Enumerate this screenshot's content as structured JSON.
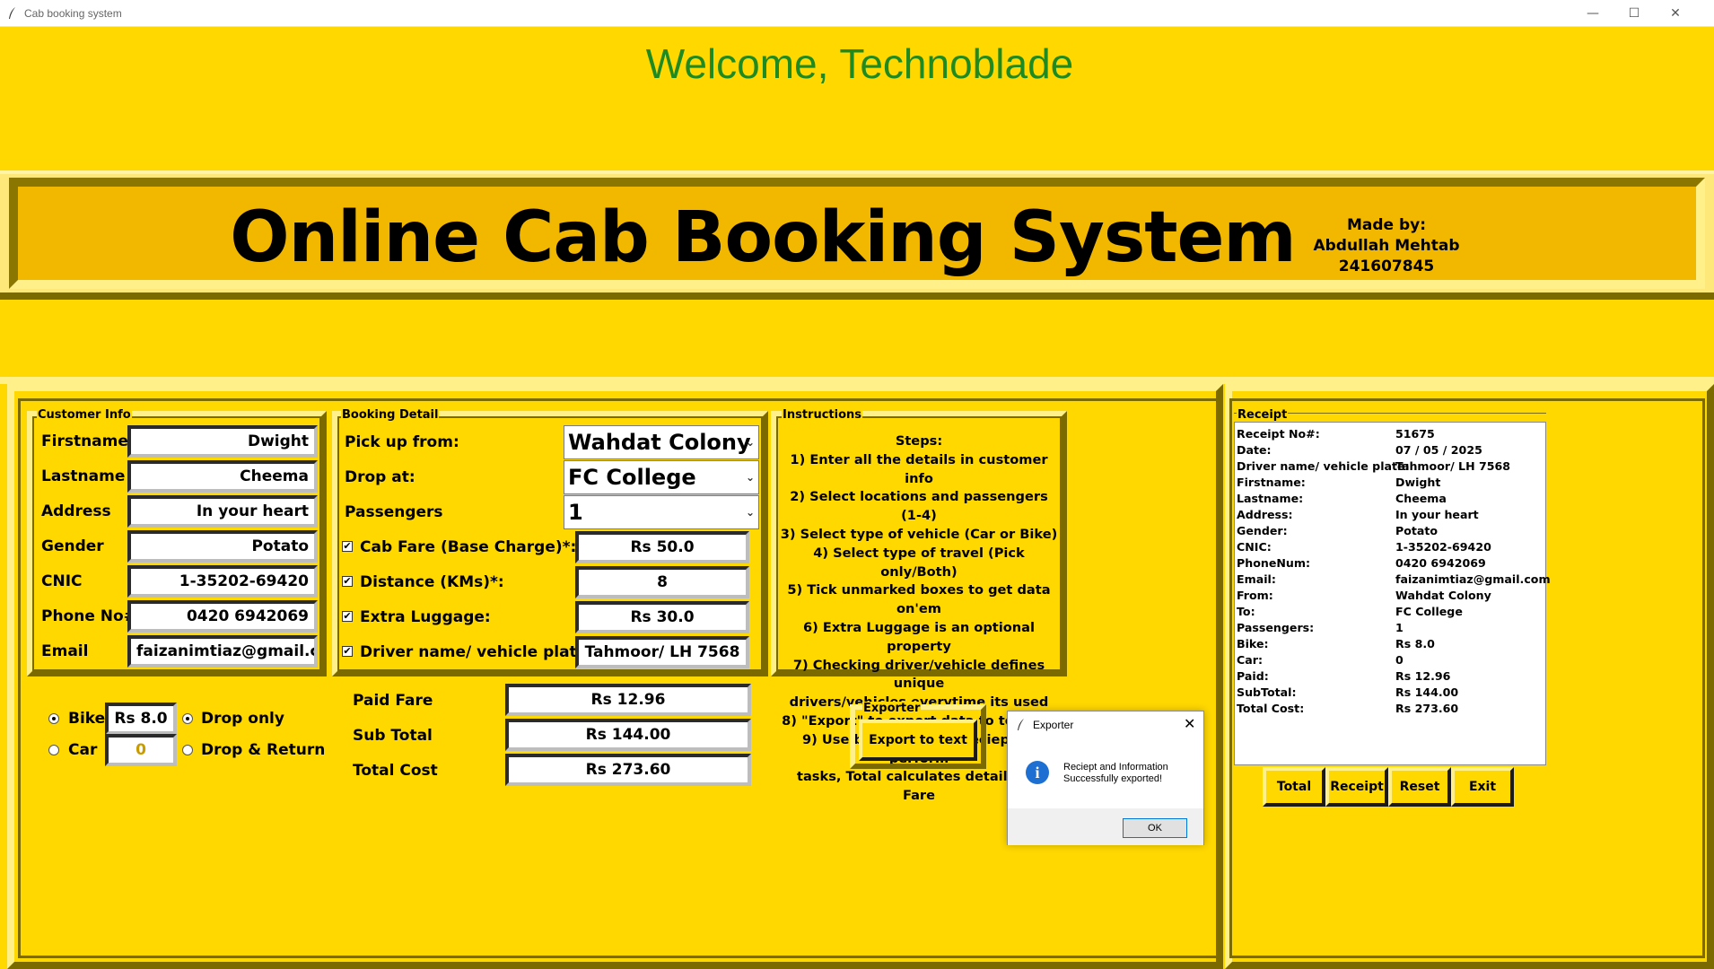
{
  "window": {
    "title": "Cab booking system",
    "minimize": "—",
    "maximize": "☐",
    "close": "✕"
  },
  "welcome": "Welcome, Technoblade",
  "header": {
    "title": "Online Cab Booking System",
    "made_by_label": "Made by:",
    "author": "Abdullah Mehtab",
    "id": "241607845"
  },
  "customer_info": {
    "group_label": "Customer Info",
    "fields": [
      {
        "label": "Firstname",
        "value": "Dwight"
      },
      {
        "label": "Lastname",
        "value": "Cheema"
      },
      {
        "label": "Address",
        "value": "In your heart"
      },
      {
        "label": "Gender",
        "value": "Potato"
      },
      {
        "label": "CNIC",
        "value": "1-35202-69420"
      },
      {
        "label": "Phone No#",
        "value": "0420 6942069"
      },
      {
        "label": "Email",
        "value": "faizanimtiaz@gmail.com"
      }
    ]
  },
  "booking": {
    "group_label": "Booking Detail",
    "pickup_label": "Pick up from:",
    "pickup_value": "Wahdat Colony",
    "drop_label": "Drop at:",
    "drop_value": "FC College",
    "passengers_label": "Passengers",
    "passengers_value": "1",
    "checks": [
      {
        "label": "Cab Fare (Base Charge)*:",
        "value": "Rs 50.0",
        "checked": true
      },
      {
        "label": "Distance (KMs)*:",
        "value": "8",
        "checked": true
      },
      {
        "label": "Extra Luggage:",
        "value": "Rs 30.0",
        "checked": true
      },
      {
        "label": "Driver name/ vehicle plate:",
        "value": "Tahmoor/ LH 7568",
        "checked": true
      }
    ],
    "check_mark": "✔"
  },
  "vehicle": {
    "bike_label": "Bike",
    "bike_value": "Rs 8.0",
    "car_label": "Car",
    "car_value": "0",
    "selected": "Bike",
    "drop_only_label": "Drop only",
    "drop_return_label": "Drop & Return",
    "travel_selected": "Drop only"
  },
  "totals": {
    "paid_label": "Paid Fare",
    "paid_value": "Rs 12.96",
    "subtotal_label": "Sub Total",
    "subtotal_value": "Rs 144.00",
    "total_label": "Total Cost",
    "total_value": "Rs 273.60"
  },
  "instructions": {
    "group_label": "Instructions",
    "lines": [
      "Steps:",
      "1) Enter all the details in customer info",
      "2) Select locations and passengers (1-4)",
      "3) Select type of vehicle (Car or Bike)",
      "4) Select type of travel (Pick only/Both)",
      "5) Tick unmarked boxes to get data on'em",
      "6) Extra Luggage is an optional property",
      "7) Checking driver/vehicle defines unique",
      "drivers/vehicles everytime its used",
      "8) \"Export\" to export data to text file",
      "9) Use buttons under reciept to perform",
      "tasks, Total calculates details for Fare"
    ]
  },
  "exporter": {
    "group_label": "Exporter",
    "button": "Export to text"
  },
  "receipt": {
    "group_label": "Receipt",
    "rows": [
      {
        "k": "Receipt No#:",
        "v": "51675"
      },
      {
        "k": "Date:",
        "v": "07 / 05 / 2025"
      },
      {
        "k": "Driver name/ vehicle plate:",
        "v": "Tahmoor/ LH 7568"
      },
      {
        "k": "Firstname:",
        "v": "Dwight"
      },
      {
        "k": "Lastname:",
        "v": "Cheema"
      },
      {
        "k": "Address:",
        "v": "In your heart"
      },
      {
        "k": "Gender:",
        "v": "Potato"
      },
      {
        "k": "CNIC:",
        "v": "1-35202-69420"
      },
      {
        "k": "PhoneNum:",
        "v": "0420 6942069"
      },
      {
        "k": "Email:",
        "v": "faizanimtiaz@gmail.com"
      },
      {
        "k": "From:",
        "v": "Wahdat Colony"
      },
      {
        "k": "To:",
        "v": "FC College"
      },
      {
        "k": "Passengers:",
        "v": "1"
      },
      {
        "k": "Bike:",
        "v": "Rs 8.0"
      },
      {
        "k": "Car:",
        "v": "0"
      },
      {
        "k": "Paid:",
        "v": "Rs 12.96"
      },
      {
        "k": "SubTotal:",
        "v": "Rs 144.00"
      },
      {
        "k": "Total Cost:",
        "v": "Rs 273.60"
      }
    ],
    "buttons": [
      "Total",
      "Receipt",
      "Reset",
      "Exit"
    ]
  },
  "dialog": {
    "title": "Exporter",
    "close": "✕",
    "icon": "i",
    "message_line1": "Reciept and Information",
    "message_line2": "Successfully exported!",
    "ok": "OK"
  },
  "colors": {
    "background": "#ffd800",
    "banner": "#f2b800",
    "welcome_text": "#1f8a1f",
    "car_value_text": "#c89b00"
  }
}
